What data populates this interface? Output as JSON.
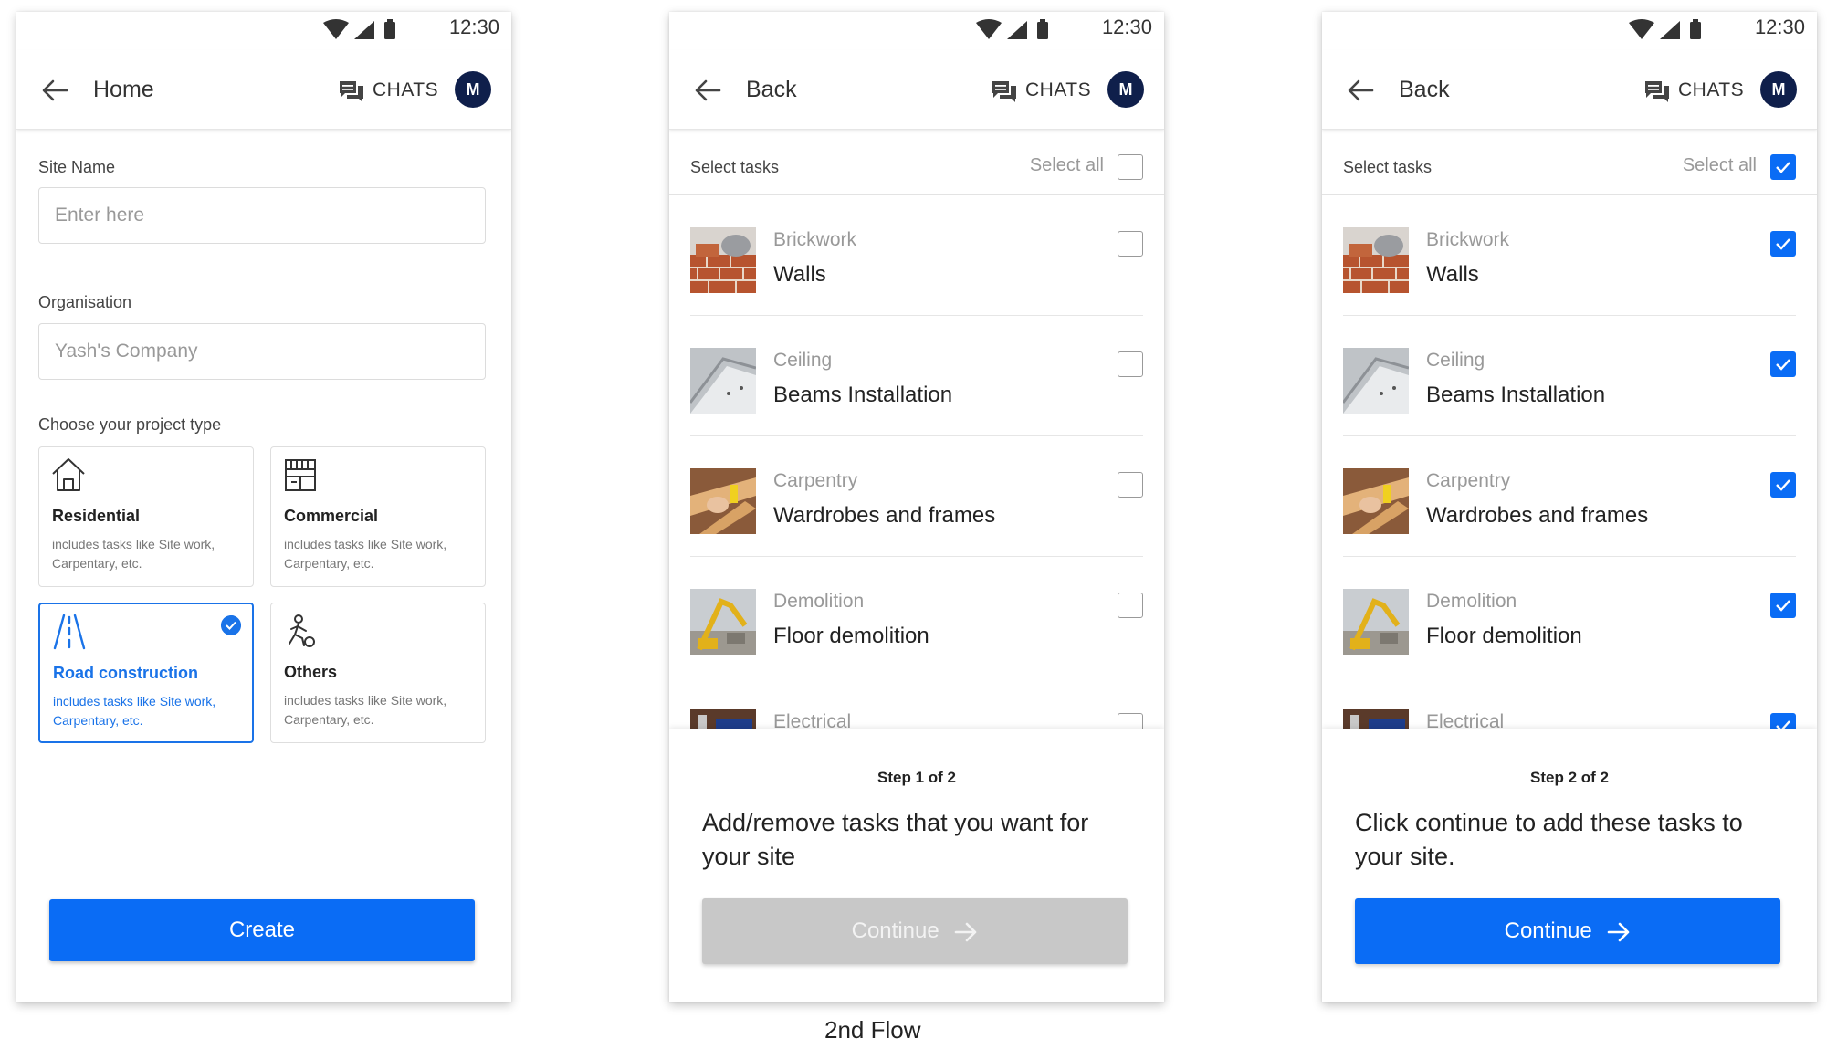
{
  "status": {
    "time": "12:30"
  },
  "screen1": {
    "header": {
      "title": "Home",
      "chats": "CHATS",
      "avatar": "M"
    },
    "site_name": {
      "label": "Site Name",
      "placeholder": "Enter here"
    },
    "organisation": {
      "label": "Organisation",
      "placeholder": "Yash's Company"
    },
    "project_type_label": "Choose your project type",
    "project_types": [
      {
        "title": "Residential",
        "desc": "includes tasks like Site work, Carpentary, etc.",
        "icon": "house-icon",
        "selected": false
      },
      {
        "title": "Commercial",
        "desc": "includes tasks like Site work, Carpentary, etc.",
        "icon": "storefront-icon",
        "selected": false
      },
      {
        "title": "Road construction",
        "desc": "includes tasks like Site work, Carpentary, etc.",
        "icon": "road-icon",
        "selected": true
      },
      {
        "title": "Others",
        "desc": "includes tasks like Site work, Carpentary, etc.",
        "icon": "worker-icon",
        "selected": false
      }
    ],
    "create_label": "Create"
  },
  "screen2": {
    "header": {
      "title": "Back",
      "chats": "CHATS",
      "avatar": "M"
    },
    "select_tasks": "Select tasks",
    "select_all": "Select all",
    "select_all_checked": false,
    "tasks": [
      {
        "category": "Brickwork",
        "name": "Walls",
        "checked": false
      },
      {
        "category": "Ceiling",
        "name": "Beams Installation",
        "checked": false
      },
      {
        "category": "Carpentry",
        "name": "Wardrobes and frames",
        "checked": false
      },
      {
        "category": "Demolition",
        "name": "Floor demolition",
        "checked": false
      },
      {
        "category": "Electrical",
        "name": "",
        "checked": false
      }
    ],
    "step": "Step 1 of 2",
    "message": "Add/remove tasks that you want for your site",
    "continue_label": "Continue",
    "continue_enabled": false
  },
  "screen3": {
    "header": {
      "title": "Back",
      "chats": "CHATS",
      "avatar": "M"
    },
    "select_tasks": "Select tasks",
    "select_all": "Select all",
    "select_all_checked": true,
    "tasks": [
      {
        "category": "Brickwork",
        "name": "Walls",
        "checked": true
      },
      {
        "category": "Ceiling",
        "name": "Beams Installation",
        "checked": true
      },
      {
        "category": "Carpentry",
        "name": "Wardrobes and frames",
        "checked": true
      },
      {
        "category": "Demolition",
        "name": "Floor demolition",
        "checked": true
      },
      {
        "category": "Electrical",
        "name": "",
        "checked": true
      }
    ],
    "step": "Step 2 of 2",
    "message": "Click continue to add  these tasks to your site.",
    "continue_label": "Continue",
    "continue_enabled": true
  },
  "caption": "2nd Flow",
  "colors": {
    "primary": "#0a6cf5",
    "avatar": "#0f1f4b",
    "disabled": "#c8c8c8"
  }
}
